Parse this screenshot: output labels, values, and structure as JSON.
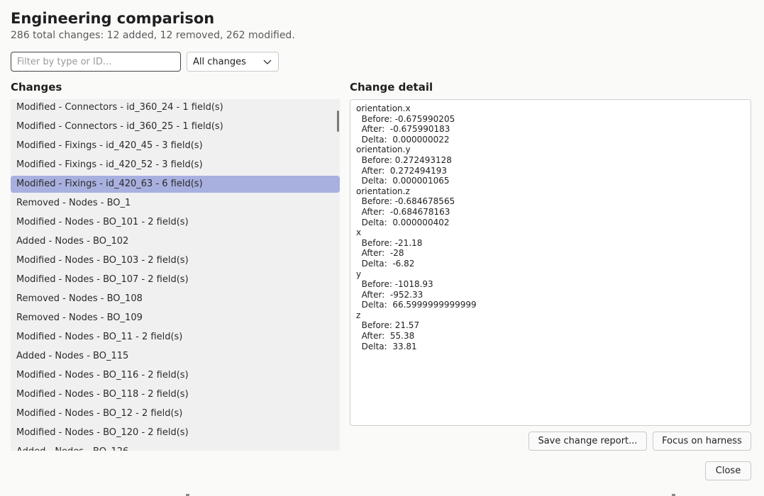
{
  "dialog": {
    "title": "Engineering comparison",
    "summary": "286 total changes: 12 added, 12 removed, 262 modified."
  },
  "filter": {
    "placeholder": "Filter by type or ID...",
    "value": ""
  },
  "change_type_select": {
    "selected": "All changes"
  },
  "changes": {
    "label": "Changes",
    "selected_index": 4,
    "items": [
      "Modified - Connectors - id_360_24 - 1 field(s)",
      "Modified - Connectors - id_360_25 - 1 field(s)",
      "Modified - Fixings - id_420_45 - 3 field(s)",
      "Modified - Fixings - id_420_52 - 3 field(s)",
      "Modified - Fixings - id_420_63 - 6 field(s)",
      "Removed - Nodes - BO_1",
      "Modified - Nodes - BO_101 - 2 field(s)",
      "Added - Nodes - BO_102",
      "Modified - Nodes - BO_103 - 2 field(s)",
      "Modified - Nodes - BO_107 - 2 field(s)",
      "Removed - Nodes - BO_108",
      "Removed - Nodes - BO_109",
      "Modified - Nodes - BO_11 - 2 field(s)",
      "Added - Nodes - BO_115",
      "Modified - Nodes - BO_116 - 2 field(s)",
      "Modified - Nodes - BO_118 - 2 field(s)",
      "Modified - Nodes - BO_12 - 2 field(s)",
      "Modified - Nodes - BO_120 - 2 field(s)",
      "Added - Nodes - BO_126"
    ]
  },
  "detail": {
    "label": "Change detail",
    "text": "orientation.x\n  Before: -0.675990205\n  After:  -0.675990183\n  Delta:  0.000000022\norientation.y\n  Before: 0.272493128\n  After:  0.272494193\n  Delta:  0.000001065\norientation.z\n  Before: -0.684678565\n  After:  -0.684678163\n  Delta:  0.000000402\nx\n  Before: -21.18\n  After:  -28\n  Delta:  -6.82\ny\n  Before: -1018.93\n  After:  -952.33\n  Delta:  66.5999999999999\nz\n  Before: 21.57\n  After:  55.38\n  Delta:  33.81"
  },
  "buttons": {
    "save_report": "Save change report...",
    "focus_harness": "Focus on harness",
    "close": "Close"
  },
  "icons": {
    "select_arrow": "chevron-down-icon"
  }
}
